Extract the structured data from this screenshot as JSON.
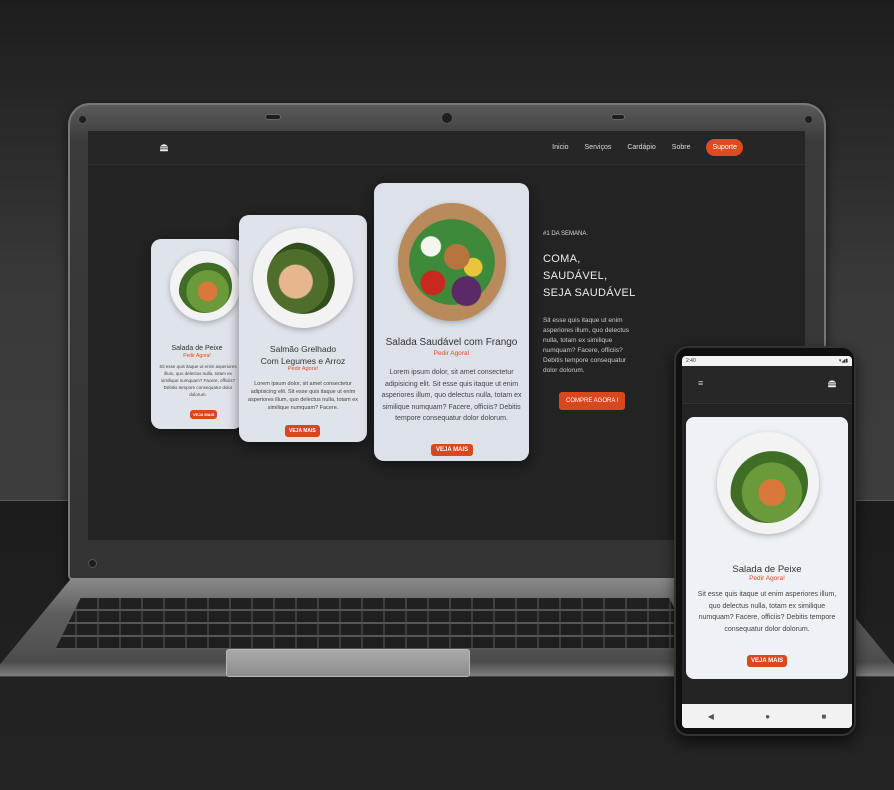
{
  "laptop": {
    "nav": {
      "logo_icon": "burger-icon",
      "links": [
        "Inicio",
        "Serviços",
        "Cardápio",
        "Sobre"
      ],
      "support_label": "Suporte"
    },
    "cards": [
      {
        "title": "Salada de Peixe",
        "subtitle": "Pedir Agora!",
        "desc": "Sit esse quis itaque ut enim asperiores illum, quo delectus nulla, totam ex similique numquam? Facere, officiis? Debitis tempore consequatur dolor dolorum.",
        "button": "VEJA MAIS"
      },
      {
        "title_line1": "Salmão Grelhado",
        "title_line2": "Com Legumes e Arroz",
        "subtitle": "Pedir Agora!",
        "desc": "Lorem ipsum dolor, sit amet consectetur adipisicing elit. Sit esse quis itaque ut enim asperiores illum, quo delectus nulla, totam ex similique numquam? Facere.",
        "button": "VEJA MAIS"
      },
      {
        "title": "Salada Saudável com Frango",
        "subtitle": "Pedir Agora!",
        "desc": "Lorem ipsum dolor, sit amet consectetur adipisicing elit. Sit esse quis itaque ut enim asperiores illum, quo delectus nulla, totam ex similique numquam? Facere, officiis? Debitis tempore consequatur dolor dolorum.",
        "button": "VEJA MAIS"
      }
    ],
    "hero": {
      "tag": "#1 DA SEMANA.",
      "title_line1": "COMA,",
      "title_line2": "SAUDÁVEL,",
      "title_line3": "SEJA SAUDÁVEL",
      "desc": "Sit esse quis itaque ut enim asperiores illum, quo delectus nulla, totam ex similique numquam? Facere, officiis? Debitis tempore consequatur dolor dolorum.",
      "cta": "COMPRE AGORA !"
    }
  },
  "phone": {
    "status_time": "2:40",
    "menu_icon": "hamburger-menu-icon",
    "logo_icon": "burger-icon",
    "card": {
      "title": "Salada de Peixe",
      "subtitle": "Pedir Agora!",
      "desc": "Sit esse quis itaque ut enim asperiores illum, quo delectus nulla, totam ex similique numquam? Facere, officiis? Debitis tempore consequatur dolor dolorum.",
      "button": "VEJA MAIS"
    },
    "nav_buttons": [
      "◀",
      "●",
      "■"
    ]
  },
  "colors": {
    "accent": "#e04a1f",
    "card_bg": "#dfe3ea",
    "screen_bg": "#232323"
  }
}
